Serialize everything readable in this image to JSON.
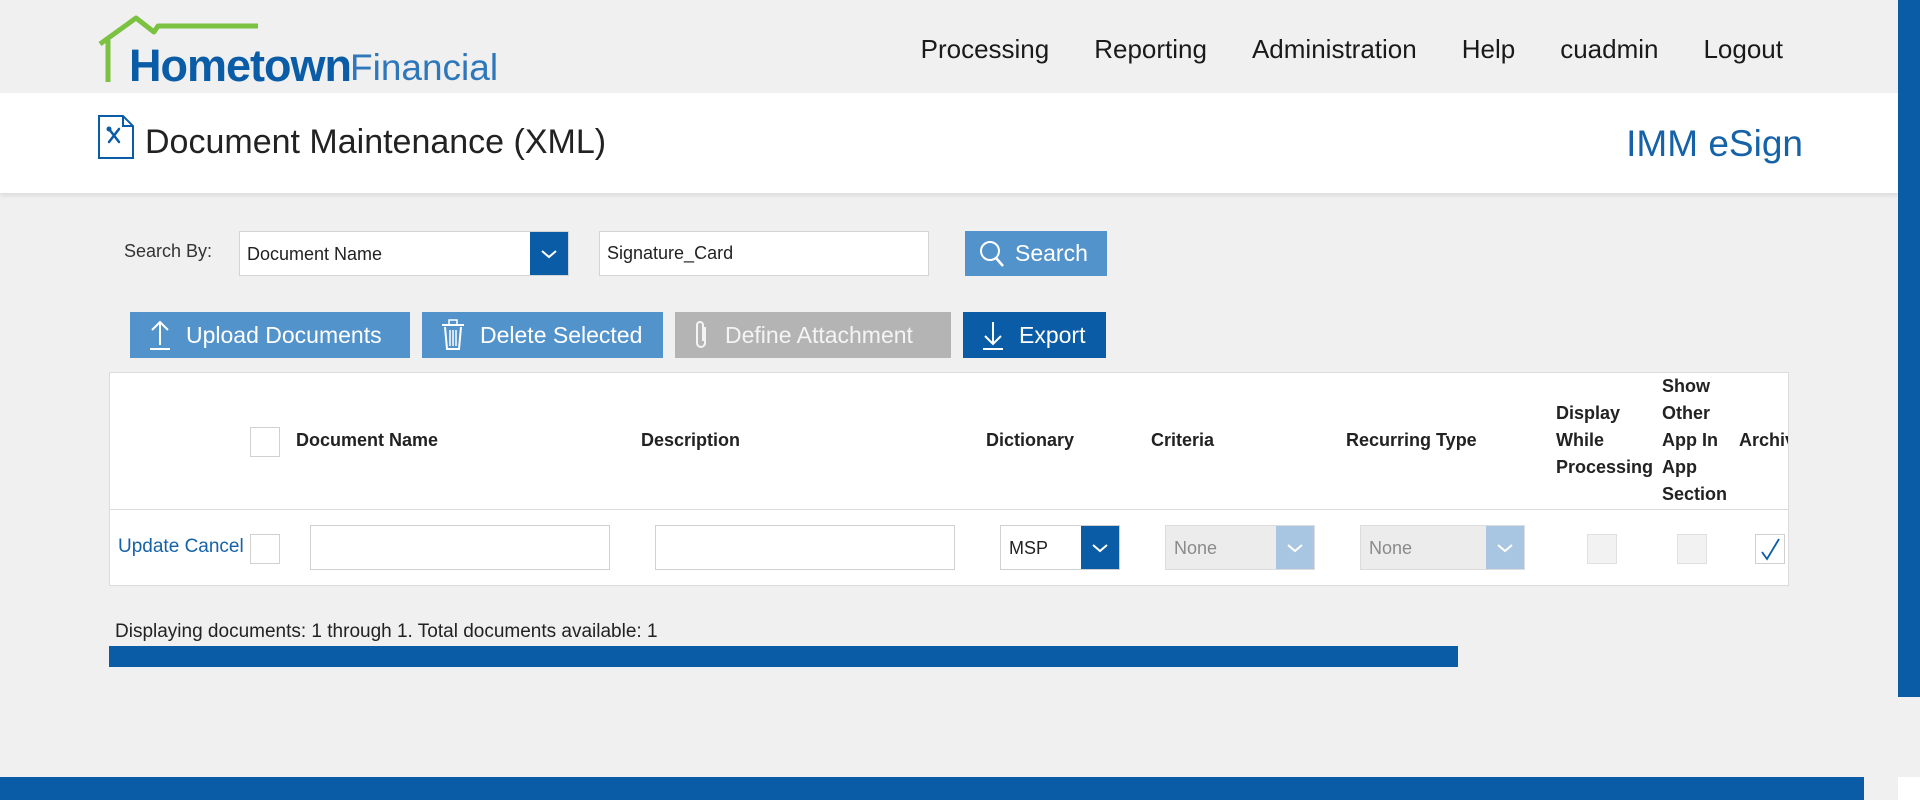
{
  "logo": {
    "brand_primary": "Hometown",
    "brand_secondary": "Financial"
  },
  "nav": [
    {
      "label": "Processing"
    },
    {
      "label": "Reporting"
    },
    {
      "label": "Administration"
    },
    {
      "label": "Help"
    },
    {
      "label": "cuadmin"
    },
    {
      "label": "Logout"
    }
  ],
  "header": {
    "title": "Document Maintenance (XML)",
    "product": "IMM eSign"
  },
  "search": {
    "label": "Search By:",
    "by_value": "Document Name",
    "query": "Signature_Card",
    "button": "Search"
  },
  "toolbar": {
    "upload": "Upload Documents",
    "delete": "Delete Selected",
    "define": "Define Attachment",
    "export": "Export"
  },
  "grid": {
    "columns": {
      "document_name": "Document Name",
      "description": "Description",
      "dictionary": "Dictionary",
      "criteria": "Criteria",
      "recurring_type": "Recurring Type",
      "display_while_processing": [
        "Display",
        "While",
        "Processing"
      ],
      "show_other_app": [
        "Show",
        "Other",
        "App In",
        "App",
        "Section"
      ],
      "archive": "Archiv"
    },
    "edit_row": {
      "update_link": "Update",
      "cancel_link": "Cancel",
      "document_name": "",
      "description": "",
      "dictionary": "MSP",
      "criteria": "None",
      "recurring_type": "None",
      "archive_checked": true
    }
  },
  "status_text": "Displaying documents: 1 through 1. Total documents available: 1",
  "colors": {
    "primary": "#0a5ca6",
    "button_light": "#5393cc",
    "logo_green": "#7cc242"
  }
}
